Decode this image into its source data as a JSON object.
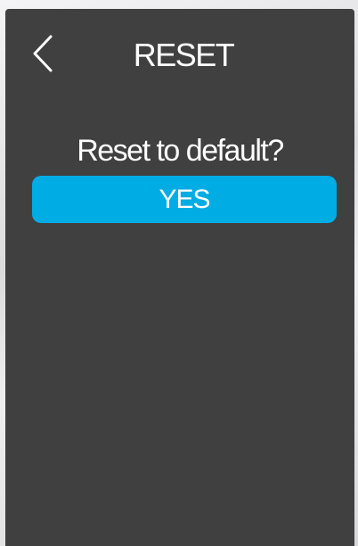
{
  "header": {
    "title": "RESET",
    "back_icon": "chevron-left-icon"
  },
  "dialog": {
    "prompt": "Reset to default?",
    "confirm_label": "YES"
  },
  "colors": {
    "screen_background": "#404040",
    "accent": "#00ace4",
    "text": "#ffffff"
  }
}
